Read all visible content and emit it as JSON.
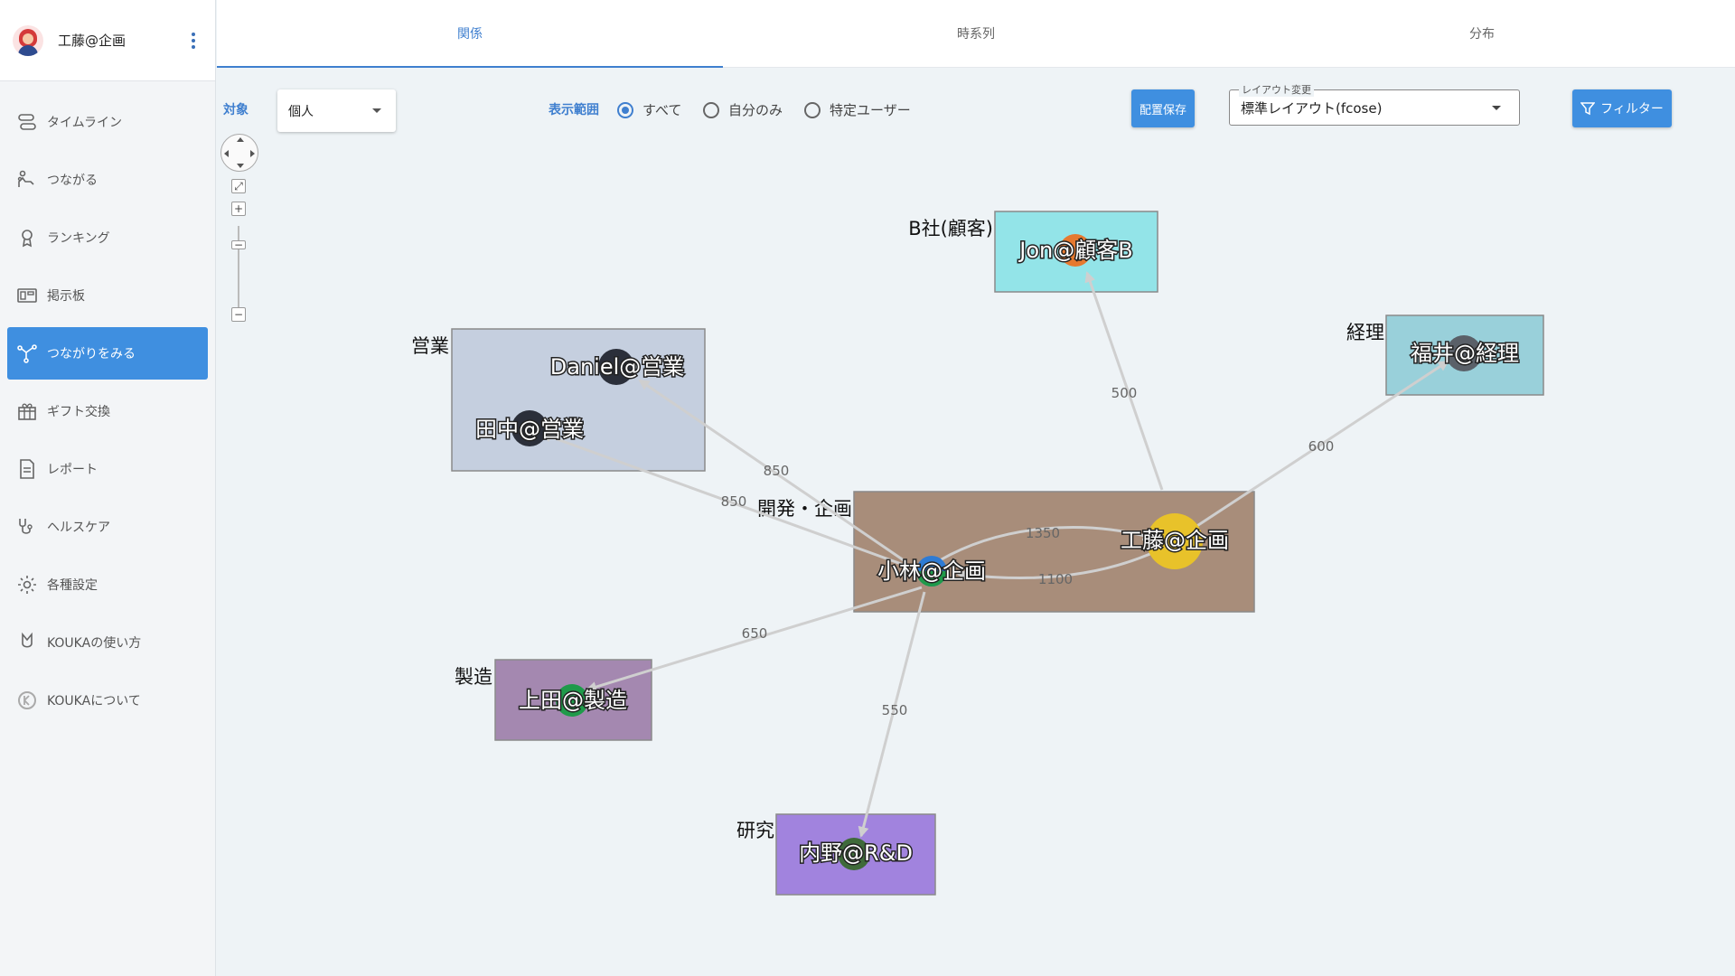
{
  "user": {
    "name": "工藤@企画"
  },
  "sidebar": {
    "items": [
      {
        "label": "タイムライン",
        "icon": "timeline-icon"
      },
      {
        "label": "つながる",
        "icon": "connect-icon"
      },
      {
        "label": "ランキング",
        "icon": "ranking-icon"
      },
      {
        "label": "掲示板",
        "icon": "board-icon"
      },
      {
        "label": "つながりをみる",
        "icon": "network-icon",
        "active": true
      },
      {
        "label": "ギフト交換",
        "icon": "gift-icon"
      },
      {
        "label": "レポート",
        "icon": "report-icon"
      },
      {
        "label": "ヘルスケア",
        "icon": "health-icon"
      },
      {
        "label": "各種設定",
        "icon": "gear-icon"
      },
      {
        "label": "KOUKAの使い方",
        "icon": "guide-icon"
      },
      {
        "label": "KOUKAについて",
        "icon": "kouka-logo-icon"
      }
    ]
  },
  "tabs": [
    {
      "label": "関係",
      "active": true
    },
    {
      "label": "時系列"
    },
    {
      "label": "分布"
    }
  ],
  "toolbar": {
    "target_label": "対象",
    "target_value": "個人",
    "range_label": "表示範囲",
    "range_options": [
      "すべて",
      "自分のみ",
      "特定ユーザー"
    ],
    "range_selected": "すべて",
    "save_label": "配置保存",
    "layout_legend": "レイアウト変更",
    "layout_value": "標準レイアウト(fcose)",
    "filter_label": "フィルター"
  },
  "graph": {
    "groups": [
      {
        "name": "B社(顧客)",
        "color": "#93e4e8"
      },
      {
        "name": "営業",
        "color": "#c5cfdf"
      },
      {
        "name": "経理",
        "color": "#99d0da"
      },
      {
        "name": "開発・企画",
        "color": "#a88d7a"
      },
      {
        "name": "製造",
        "color": "#a488b0"
      },
      {
        "name": "研究",
        "color": "#a183de"
      }
    ],
    "nodes": [
      {
        "id": "jon",
        "label": "Jon@顧客B",
        "group": "B社(顧客)",
        "color": "#e6792f"
      },
      {
        "id": "daniel",
        "label": "Daniel@営業",
        "group": "営業",
        "color": "#2b2f3a"
      },
      {
        "id": "tanaka",
        "label": "田中@営業",
        "group": "営業",
        "color": "#2b2f3a"
      },
      {
        "id": "fukui",
        "label": "福井@経理",
        "group": "経理",
        "color": "#5a6068"
      },
      {
        "id": "kobayashi",
        "label": "小林@企画",
        "group": "開発・企画",
        "color": "#2e7bd4"
      },
      {
        "id": "kudo",
        "label": "工藤@企画",
        "group": "開発・企画",
        "color": "#e8c22a"
      },
      {
        "id": "ueda",
        "label": "上田@製造",
        "group": "製造",
        "color": "#1f9a4a"
      },
      {
        "id": "uchino",
        "label": "内野@R&D",
        "group": "研究",
        "color": "#3f6a3a"
      }
    ],
    "edges": [
      {
        "from": "kudo",
        "to": "jon",
        "label": "500"
      },
      {
        "from": "kudo",
        "to": "fukui",
        "label": "600"
      },
      {
        "from": "kobayashi",
        "to": "daniel",
        "label": "850"
      },
      {
        "from": "kobayashi",
        "to": "tanaka",
        "label": "850"
      },
      {
        "from": "kobayashi",
        "to": "kudo",
        "label": "1350"
      },
      {
        "from": "kudo",
        "to": "kobayashi",
        "label": "1100"
      },
      {
        "from": "kobayashi",
        "to": "ueda",
        "label": "650"
      },
      {
        "from": "kobayashi",
        "to": "uchino",
        "label": "550"
      }
    ]
  }
}
